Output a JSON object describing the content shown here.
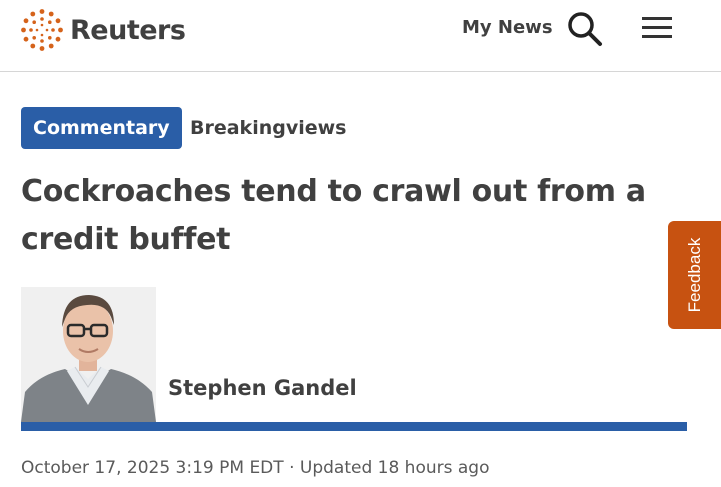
{
  "header": {
    "brand": "Reuters",
    "my_news_label": "My News",
    "icons": {
      "logo": "reuters-dot-logo",
      "search": "search-icon",
      "menu": "hamburger-menu-icon"
    }
  },
  "article": {
    "tags": [
      "Commentary",
      "Breakingviews"
    ],
    "headline": "Cockroaches tend to crawl out from a credit buffet",
    "author": "Stephen Gandel",
    "dateline": "October 17, 2025 3:19 PM EDT · Updated 18 hours ago"
  },
  "feedback": {
    "label": "Feedback"
  },
  "colors": {
    "brand_orange": "#d5631b",
    "tag_blue": "#2a5ea7",
    "feedback_bg": "#c75211",
    "text": "#404040"
  }
}
